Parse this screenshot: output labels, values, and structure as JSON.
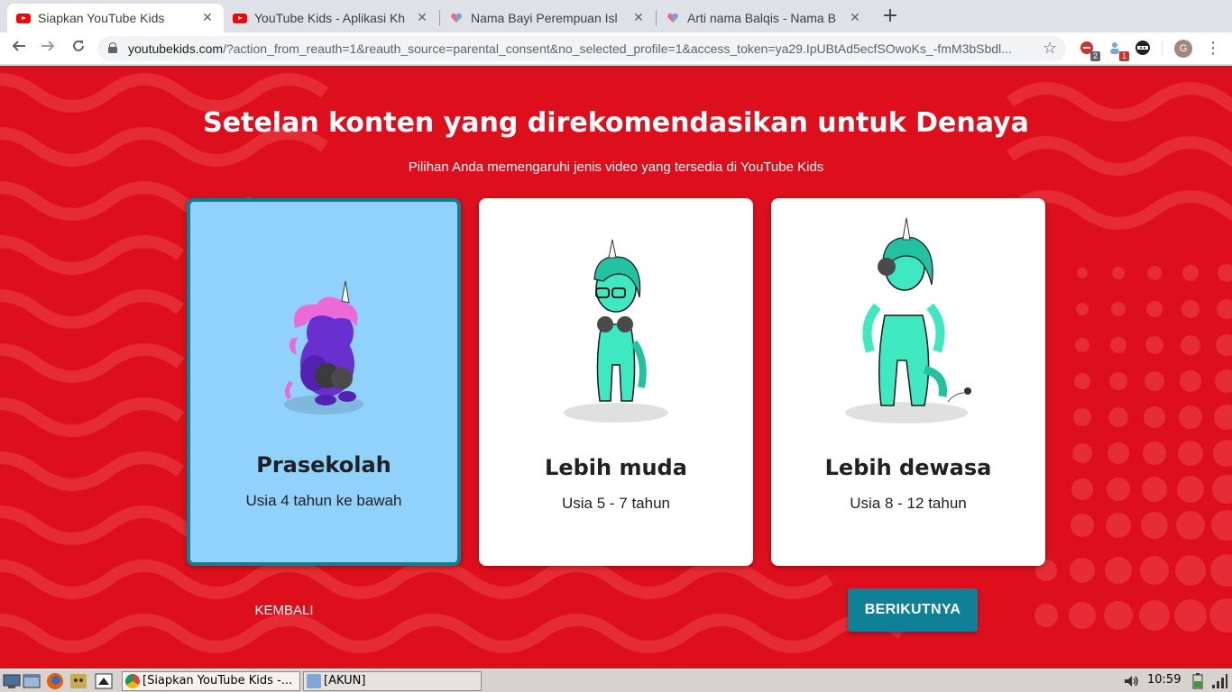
{
  "browser": {
    "tabs": [
      {
        "title": "Siapkan YouTube Kids",
        "favicon": "youtube-icon",
        "active": true
      },
      {
        "title": "YouTube Kids - Aplikasi Kh",
        "favicon": "youtube-icon",
        "active": false
      },
      {
        "title": "Nama Bayi Perempuan Isl",
        "favicon": "heart-icon",
        "active": false
      },
      {
        "title": "Arti nama Balqis - Nama B",
        "favicon": "heart-icon",
        "active": false
      }
    ],
    "new_tab_label": "+",
    "url_host": "youtubekids.com",
    "url_path": "/?action_from_reauth=1&reauth_source=parental_consent&no_selected_profile=1&access_token=ya29.IpUBtAd5ecfSOwoKs_-fmM3bSbdl...",
    "extension_badges": [
      "2",
      "1"
    ],
    "profile_initial": "G"
  },
  "page": {
    "heading": "Setelan konten yang direkomendasikan untuk Denaya",
    "subheading": "Pilihan Anda memengaruhi jenis video yang tersedia di YouTube Kids",
    "cards": [
      {
        "label": "Prasekolah",
        "age": "Usia 4 tahun ke bawah",
        "selected": true
      },
      {
        "label": "Lebih muda",
        "age": "Usia 5 - 7 tahun",
        "selected": false
      },
      {
        "label": "Lebih dewasa",
        "age": "Usia 8 - 12 tahun",
        "selected": false
      }
    ],
    "back_label": "KEMBALI",
    "next_label": "BERIKUTNYA",
    "colors": {
      "background": "#dd0f1d",
      "selected_card": "#90d2fb",
      "selected_border": "#0f7f96",
      "button": "#0f8197"
    }
  },
  "taskbar": {
    "tasks": [
      {
        "label": "[Siapkan YouTube Kids -...",
        "icon": "chrome-icon"
      },
      {
        "label": "[AKUN]",
        "icon": "folder-icon"
      }
    ],
    "clock": "10:59"
  }
}
